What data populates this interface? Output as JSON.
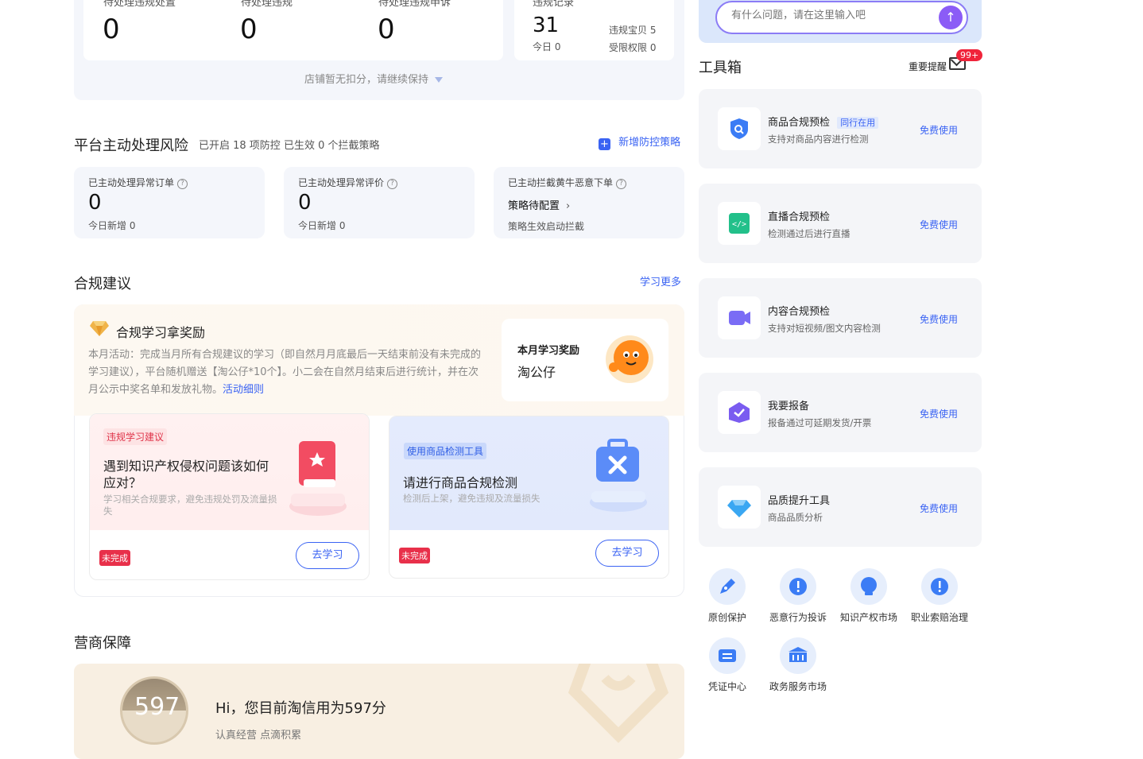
{
  "top": {
    "labels": [
      "待处理违规处置",
      "待处理违规",
      "待处理违规申诉"
    ],
    "values": [
      "0",
      "0",
      "0"
    ],
    "right_label": "违规记录",
    "right_value": "31",
    "today": "今日 0",
    "bad_baby": "违规宝贝 5",
    "restricted": "受限权限 0",
    "notice": "店铺暂无扣分，请继续保持"
  },
  "risk": {
    "title": "平台主动处理风险",
    "summary": "已开启 18 项防控 已生效 0 个拦截策略",
    "add_label": "新增防控策略",
    "cards": [
      {
        "label": "已主动处理异常订单",
        "value": "0",
        "sub": "今日新增 0"
      },
      {
        "label": "已主动处理异常评价",
        "value": "0",
        "sub": "今日新增 0"
      },
      {
        "label": "已主动拦截黄牛恶意下单",
        "value": "策略待配置",
        "sub": "策略生效启动拦截"
      }
    ]
  },
  "compliance": {
    "title": "合规建议",
    "more": "学习更多",
    "reward_title": "合规学习拿奖励",
    "reward_text": "本月活动：完成当月所有合规建议的学习（即自然月月底最后一天结束前没有未完成的学习建议），平台随机赠送【淘公仔*10个】。小二会在自然月结束后进行统计，并在次月公示中奖名单和发放礼物。",
    "reward_link": "活动细则",
    "month_reward_label": "本月学习奖励",
    "month_reward_value": "淘公仔",
    "tasks": [
      {
        "tag": "违规学习建议",
        "title": "遇到知识产权侵权问题该如何应对？",
        "desc": "学习相关合规要求，避免违规处罚及流量损失",
        "status": "未完成",
        "btn": "去学习"
      },
      {
        "tag": "使用商品检测工具",
        "title": "请进行商品合规检测",
        "desc": "检测后上架，避免违规及流量损失",
        "status": "未完成",
        "btn": "去学习"
      }
    ]
  },
  "credit": {
    "title": "营商保障",
    "score": "597",
    "greeting": "Hi，您目前淘信用为597分",
    "slogan": "认真经营 点滴积累"
  },
  "sidebar": {
    "search_placeholder": "有什么问题，请在这里输入吧",
    "toolbox_title": "工具箱",
    "reminder_label": "重要提醒",
    "badge": "99+",
    "tools": [
      {
        "title": "商品合规预检",
        "tag": "同行在用",
        "desc": "支持对商品内容进行检测",
        "action": "免费使用",
        "color": "#3b7cf5"
      },
      {
        "title": "直播合规预检",
        "tag": "",
        "desc": "检测通过后进行直播",
        "action": "免费使用",
        "color": "#22c08a"
      },
      {
        "title": "内容合规预检",
        "tag": "",
        "desc": "支持对短视频/图文内容检测",
        "action": "免费使用",
        "color": "#7a6cf5"
      },
      {
        "title": "我要报备",
        "tag": "",
        "desc": "报备通过可延期发货/开票",
        "action": "免费使用",
        "color": "#7a5cf0"
      },
      {
        "title": "品质提升工具",
        "tag": "",
        "desc": "商品品质分析",
        "action": "免费使用",
        "color": "#3aa7f2"
      }
    ],
    "quick": [
      {
        "label": "原创保护",
        "icon": "pen-icon"
      },
      {
        "label": "恶意行为投诉",
        "icon": "alert-icon"
      },
      {
        "label": "知识产权市场",
        "icon": "bulb-icon"
      },
      {
        "label": "职业索赔治理",
        "icon": "alert-icon"
      },
      {
        "label": "凭证中心",
        "icon": "ticket-icon"
      },
      {
        "label": "政务服务市场",
        "icon": "bank-icon"
      }
    ]
  }
}
